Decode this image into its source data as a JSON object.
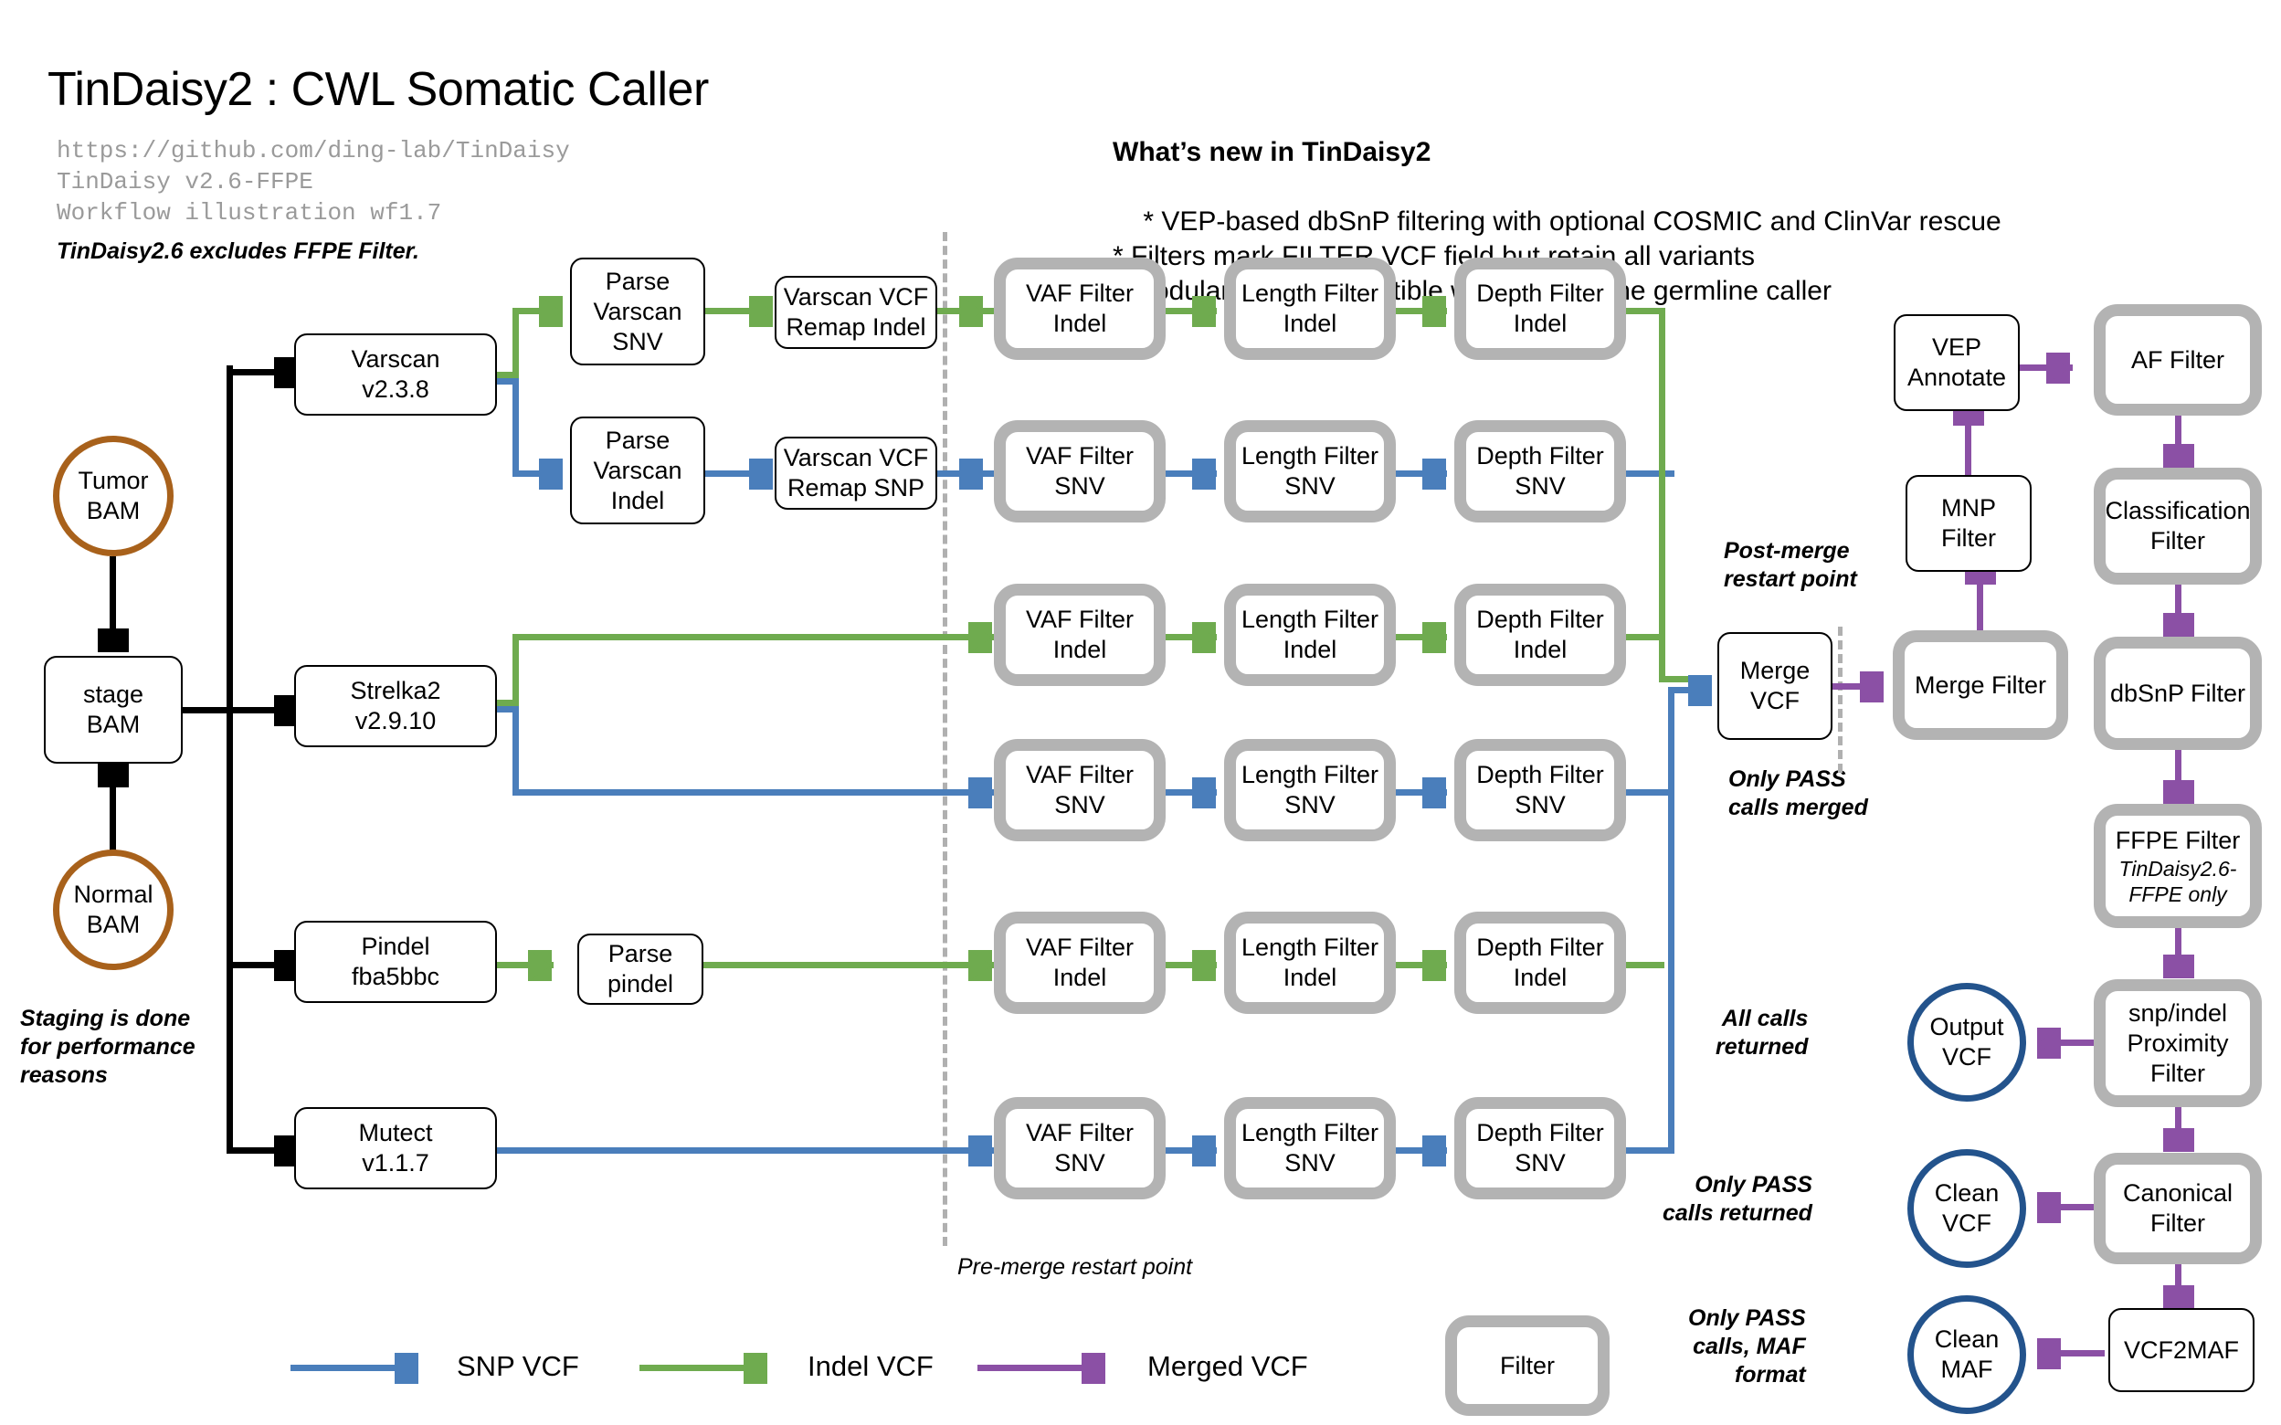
{
  "header": {
    "title": "TinDaisy2 : CWL Somatic Caller",
    "meta_lines": "https://github.com/ding-lab/TinDaisy\nTinDaisy v2.6-FFPE\nWorkflow illustration wf1.7",
    "ffpe_note": "TinDaisy2.6 excludes FFPE Filter."
  },
  "whats_new": {
    "heading": "What’s new in TinDaisy2",
    "bullets": "* VEP-based dbSnP filtering with optional COSMIC and ClinVar rescue\n* Filters mark FILTER VCF field but retain all variants\n* Modular filters compatible with TinJasmine germline caller"
  },
  "inputs": {
    "tumor_bam": "Tumor\nBAM",
    "normal_bam": "Normal\nBAM",
    "stage_bam": "stage\nBAM",
    "staging_note": "Staging is done\nfor performance\nreasons"
  },
  "callers": [
    {
      "label": "Varscan\nv2.3.8"
    },
    {
      "label": "Strelka2\nv2.9.10"
    },
    {
      "label": "Pindel\nfba5bbc"
    },
    {
      "label": "Mutect\nv1.1.7"
    }
  ],
  "parsers": [
    {
      "label": "Parse\nVarscan\nSNV"
    },
    {
      "label": "Parse\nVarscan\nIndel"
    },
    {
      "label": "Parse\npindel"
    }
  ],
  "remaps": [
    {
      "label": "Varscan VCF\nRemap Indel"
    },
    {
      "label": "Varscan VCF\nRemap SNP"
    }
  ],
  "filter_rows": [
    {
      "vaf": "VAF Filter\nIndel",
      "length": "Length Filter\nIndel",
      "depth": "Depth Filter\nIndel"
    },
    {
      "vaf": "VAF Filter\nSNV",
      "length": "Length Filter\nSNV",
      "depth": "Depth Filter\nSNV"
    },
    {
      "vaf": "VAF Filter\nIndel",
      "length": "Length Filter\nIndel",
      "depth": "Depth Filter\nIndel"
    },
    {
      "vaf": "VAF Filter\nSNV",
      "length": "Length Filter\nSNV",
      "depth": "Depth Filter\nSNV"
    },
    {
      "vaf": "VAF Filter\nIndel",
      "length": "Length Filter\nIndel",
      "depth": "Depth Filter\nIndel"
    },
    {
      "vaf": "VAF Filter\nSNV",
      "length": "Length Filter\nSNV",
      "depth": "Depth Filter\nSNV"
    }
  ],
  "merge": {
    "merge_vcf": "Merge\nVCF",
    "merge_filter": "Merge Filter",
    "mnp_filter": "MNP\nFilter",
    "vep_annotate": "VEP\nAnnotate",
    "post_merge_note": "Post-merge\nrestart point",
    "pass_merged_note": "Only PASS\ncalls merged",
    "pre_merge_note": "Pre-merge restart point"
  },
  "post_filters": [
    {
      "label": "AF Filter",
      "sub": ""
    },
    {
      "label": "Classification\nFilter",
      "sub": ""
    },
    {
      "label": "dbSnP Filter",
      "sub": ""
    },
    {
      "label": "FFPE Filter",
      "sub": "TinDaisy2.6-\nFFPE only"
    },
    {
      "label": "snp/indel\nProximity\nFilter",
      "sub": ""
    },
    {
      "label": "Canonical\nFilter",
      "sub": ""
    }
  ],
  "vcf2maf": {
    "label": "VCF2MAF"
  },
  "outputs": [
    {
      "label": "Output\nVCF",
      "note": "All calls\nreturned"
    },
    {
      "label": "Clean\nVCF",
      "note": "Only PASS\ncalls returned"
    },
    {
      "label": "Clean\nMAF",
      "note": "Only PASS\ncalls, MAF\nformat"
    }
  ],
  "legend": {
    "snp": "SNP VCF",
    "indel": "Indel VCF",
    "merged": "Merged VCF",
    "filter_box": "Filter"
  },
  "colors": {
    "snp_blue": "#4a7ebb",
    "indel_green": "#6fab4f",
    "merged_purple": "#8b50a5",
    "bam_orange": "#a8611b",
    "output_blue": "#23538c",
    "filter_grey": "#b3b3b3"
  }
}
